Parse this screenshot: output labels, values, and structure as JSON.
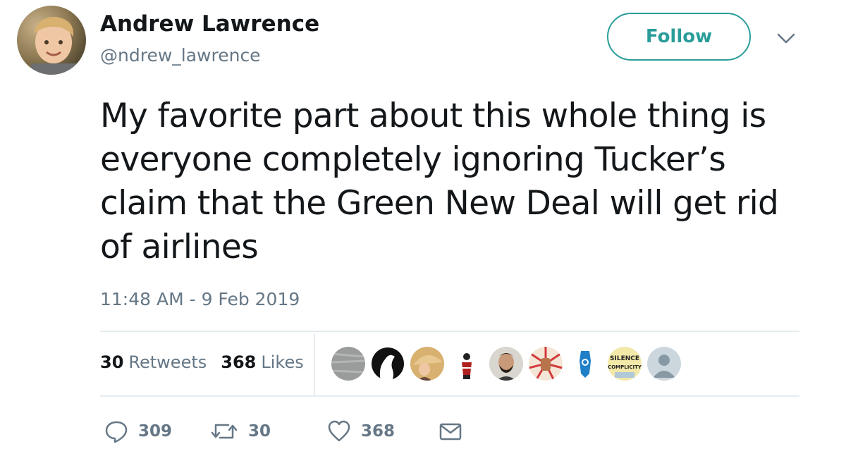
{
  "author": {
    "display_name": "Andrew Lawrence",
    "handle": "@ndrew_lawrence",
    "avatar_icon": "avatar-photo"
  },
  "follow_button": {
    "label": "Follow",
    "color": "#2a9d9a"
  },
  "menu_icon": "chevron-down-icon",
  "tweet": {
    "text": "My favorite part about this whole thing is everyone completely ignoring Tucker’s claim that the Green New Deal will get rid of airlines",
    "timestamp": "11:48 AM - 9 Feb 2019"
  },
  "stats": {
    "retweets_count": "30",
    "retweets_label": "Retweets",
    "likes_count": "368",
    "likes_label": "Likes"
  },
  "likers": [
    {
      "icon": "gray-texture-avatar"
    },
    {
      "icon": "silhouette-avatar"
    },
    {
      "icon": "umbrella-avatar"
    },
    {
      "icon": "figurine-avatar"
    },
    {
      "icon": "bearded-man-avatar"
    },
    {
      "icon": "fist-avatar"
    },
    {
      "icon": "lake-tahoe-avatar"
    },
    {
      "icon": "silence-complicity-avatar",
      "text": "SILENCE COMPLICITY"
    },
    {
      "icon": "default-user-avatar"
    }
  ],
  "actions": {
    "reply_count": "309",
    "retweet_count": "30",
    "like_count": "368",
    "reply_icon": "reply-icon",
    "retweet_icon": "retweet-icon",
    "like_icon": "heart-icon",
    "message_icon": "envelope-icon"
  },
  "colors": {
    "text": "#14171a",
    "secondary": "#657786",
    "divider": "#e6ecf0",
    "accent": "#2a9d9a"
  }
}
